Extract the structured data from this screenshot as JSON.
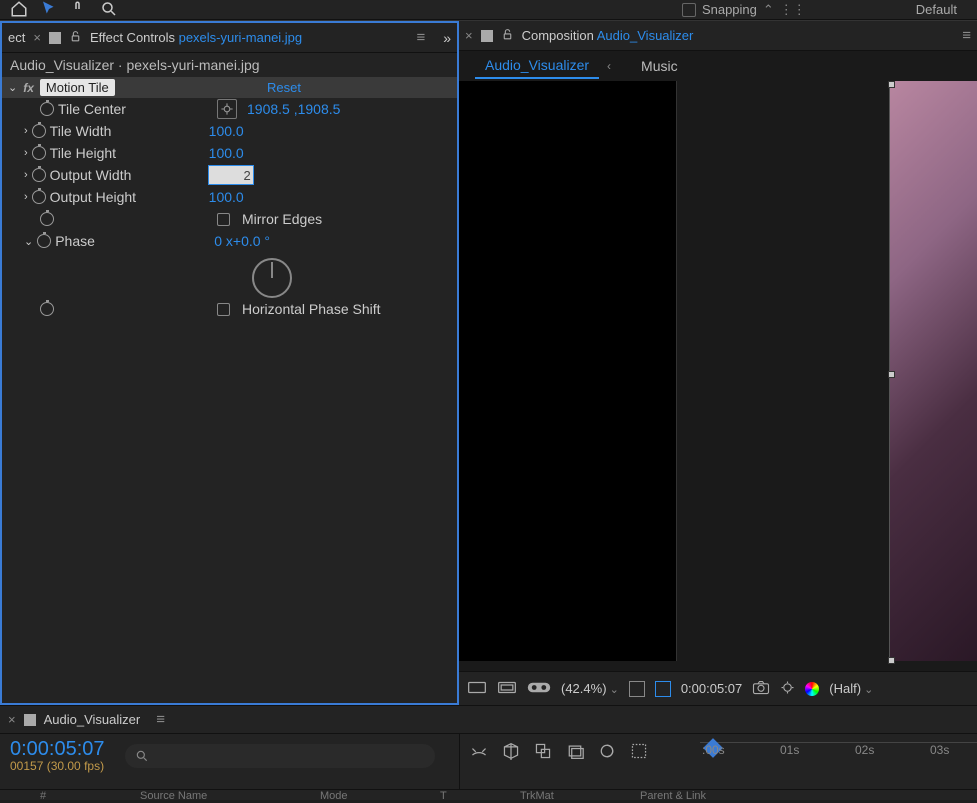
{
  "toolbar": {
    "snapping_label": "Snapping",
    "workspace": "Default"
  },
  "effect_panel": {
    "tab_title_prefix": "Effect Controls",
    "tab_title_file": "pexels-yuri-manei.jpg",
    "breadcrumb": "Audio_Visualizer · pexels-yuri-manei.jpg",
    "effect_name": "Motion Tile",
    "reset_label": "Reset",
    "props": {
      "tile_center_label": "Tile Center",
      "tile_center_x": "1908.5",
      "tile_center_y": "1908.5",
      "tile_width_label": "Tile Width",
      "tile_width_val": "100.0",
      "tile_height_label": "Tile Height",
      "tile_height_val": "100.0",
      "output_width_label": "Output Width",
      "output_width_val": "2",
      "output_height_label": "Output Height",
      "output_height_val": "100.0",
      "mirror_edges_label": "Mirror Edges",
      "phase_label": "Phase",
      "phase_val": "0 x+0.0 °",
      "horiz_phase_label": "Horizontal Phase Shift"
    }
  },
  "comp_panel": {
    "tab_title_prefix": "Composition",
    "tab_title_name": "Audio_Visualizer",
    "subtabs": {
      "active": "Audio_Visualizer",
      "other": "Music"
    },
    "footer": {
      "zoom": "(42.4%)",
      "timecode": "0:00:05:07",
      "res": "(Half)"
    }
  },
  "timeline": {
    "tab_name": "Audio_Visualizer",
    "timecode": "0:00:05:07",
    "framecount": "00157 (30.00 fps)",
    "ruler": [
      ":00s",
      "01s",
      "02s",
      "03s"
    ],
    "columns": [
      "#",
      "Source Name",
      "Mode",
      "T",
      "TrkMat",
      "Parent & Link"
    ]
  }
}
